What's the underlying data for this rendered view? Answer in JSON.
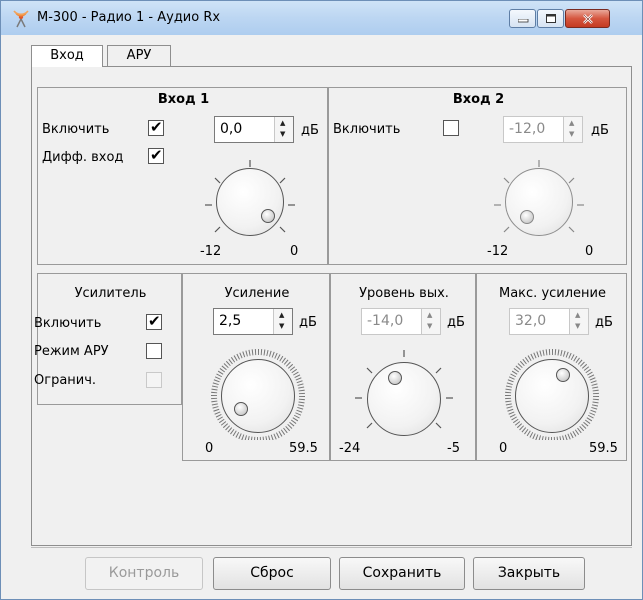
{
  "window": {
    "title": "M-300 - Радио 1 - Аудио Rx"
  },
  "tabs": [
    {
      "label": "Вход"
    },
    {
      "label": "АРУ"
    }
  ],
  "input1": {
    "title": "Вход 1",
    "enable_label": "Включить",
    "enable_checked": true,
    "diff_label": "Дифф. вход",
    "diff_checked": true,
    "value": "0,0",
    "unit": "дБ",
    "min_label": "-12",
    "max_label": "0"
  },
  "input2": {
    "title": "Вход 2",
    "enable_label": "Включить",
    "enable_checked": false,
    "value": "-12,0",
    "unit": "дБ",
    "min_label": "-12",
    "max_label": "0"
  },
  "amplifier": {
    "title": "Усилитель",
    "enable_label": "Включить",
    "enable_checked": true,
    "agc_label": "Режим АРУ",
    "agc_checked": false,
    "limit_label": "Огранич.",
    "limit_checked": false
  },
  "gain": {
    "title": "Усиление",
    "value": "2,5",
    "unit": "дБ",
    "min_label": "0",
    "max_label": "59.5"
  },
  "output_level": {
    "title": "Уровень вых.",
    "value": "-14,0",
    "unit": "дБ",
    "min_label": "-24",
    "max_label": "-5"
  },
  "max_gain": {
    "title": "Макс. усиление",
    "value": "32,0",
    "unit": "дБ",
    "min_label": "0",
    "max_label": "59.5"
  },
  "buttons": {
    "control": "Контроль",
    "reset": "Сброс",
    "save": "Сохранить",
    "close": "Закрыть"
  }
}
